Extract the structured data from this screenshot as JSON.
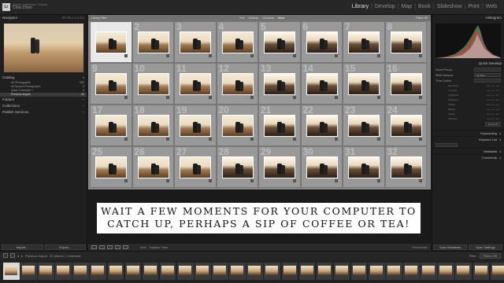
{
  "app": {
    "logo_text": "Lr",
    "identity_line1": "Adobe Lightroom Classic",
    "identity_line2": "Chris Dunn"
  },
  "modules": [
    "Library",
    "Develop",
    "Map",
    "Book",
    "Slideshow",
    "Print",
    "Web"
  ],
  "active_module": "Library",
  "left_panel": {
    "navigator_title": "Navigator",
    "navigator_zoom": "FIT  FILL  1:1  3:1",
    "catalog_title": "Catalog",
    "catalog_items": [
      {
        "label": "All Photographs",
        "count": "982"
      },
      {
        "label": "All Synced Photographs",
        "count": "0"
      },
      {
        "label": "Quick Collection +",
        "count": "0"
      },
      {
        "label": "Previous Import",
        "count": "32"
      }
    ],
    "sections": [
      "Folders",
      "Collections",
      "Publish Services"
    ],
    "import_label": "Import...",
    "export_label": "Export..."
  },
  "grid": {
    "header_left": "Library Filter :",
    "filters": [
      "Text",
      "Attribute",
      "Metadata",
      "None"
    ],
    "active_filter": "None",
    "header_right": "Filters Off",
    "selected_index": 1,
    "cells": [
      {
        "n": "1",
        "dark": false
      },
      {
        "n": "2",
        "dark": false
      },
      {
        "n": "3",
        "dark": false
      },
      {
        "n": "4",
        "dark": false
      },
      {
        "n": "5",
        "dark": true
      },
      {
        "n": "6",
        "dark": true
      },
      {
        "n": "7",
        "dark": true
      },
      {
        "n": "8",
        "dark": true
      },
      {
        "n": "9",
        "dark": false
      },
      {
        "n": "10",
        "dark": false
      },
      {
        "n": "11",
        "dark": false
      },
      {
        "n": "12",
        "dark": false
      },
      {
        "n": "13",
        "dark": true
      },
      {
        "n": "14",
        "dark": true
      },
      {
        "n": "15",
        "dark": true
      },
      {
        "n": "16",
        "dark": true
      },
      {
        "n": "17",
        "dark": false
      },
      {
        "n": "18",
        "dark": false
      },
      {
        "n": "19",
        "dark": false
      },
      {
        "n": "20",
        "dark": false
      },
      {
        "n": "21",
        "dark": true
      },
      {
        "n": "22",
        "dark": true
      },
      {
        "n": "23",
        "dark": true
      },
      {
        "n": "24",
        "dark": true
      },
      {
        "n": "25",
        "dark": false
      },
      {
        "n": "26",
        "dark": false
      },
      {
        "n": "27",
        "dark": false
      },
      {
        "n": "28",
        "dark": true
      },
      {
        "n": "29",
        "dark": true
      },
      {
        "n": "30",
        "dark": true
      },
      {
        "n": "31",
        "dark": true
      },
      {
        "n": "32",
        "dark": true
      }
    ]
  },
  "overlay": {
    "line1": "WAIT A FEW MOMENTS FOR YOUR COMPUTER TO",
    "line2": "CATCH UP, PERHAPS A SIP OF COFFEE OR TEA!"
  },
  "toolbar": {
    "sort_label": "Sort:",
    "sort_value": "Capture Time",
    "thumbnails_label": "Thumbnails"
  },
  "right_panel": {
    "histogram_title": "Histogram",
    "quick_develop_title": "Quick Develop",
    "saved_preset_label": "Saved Preset",
    "saved_preset_value": "",
    "white_balance_label": "White Balance",
    "white_balance_value": "As Shot",
    "tone_control_label": "Tone Control",
    "tone_rows": [
      "Exposure",
      "Contrast",
      "Highlights",
      "Shadows",
      "Whites",
      "Blacks",
      "Clarity",
      "Vibrance"
    ],
    "reset_label": "Reset All",
    "sections": [
      "Keywording",
      "Keyword List",
      "Metadata",
      "Comments"
    ],
    "sync_metadata_label": "Sync Metadata",
    "sync_settings_label": "Sync Settings"
  },
  "filmbar": {
    "source_label": "Previous Import",
    "count_text": "32 photos / 1 selected",
    "filter_label": "Filter:",
    "filter_value": "Filters Off"
  },
  "colors": {
    "grid_background": "#8a8a8a",
    "selected_cell": "#e8e8e8",
    "panel": "#1f1f1f"
  }
}
